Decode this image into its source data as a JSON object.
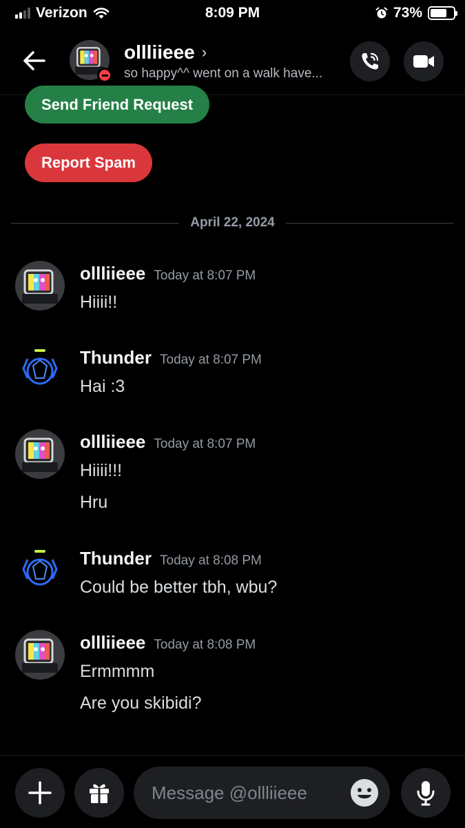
{
  "status_bar": {
    "carrier": "Verizon",
    "time": "8:09 PM",
    "battery_percent": "73%",
    "battery_level": 0.73
  },
  "header": {
    "username": "ollliieee",
    "chevron": "›",
    "custom_status": "so happy^^ went on a walk have...",
    "presence": "do-not-disturb"
  },
  "actions": {
    "send_friend_request": "Send Friend Request",
    "report_spam": "Report Spam"
  },
  "date_divider": "April 22, 2024",
  "messages": [
    {
      "author": "ollliieee",
      "timestamp": "Today at 8:07 PM",
      "lines": [
        "Hiiii!!"
      ]
    },
    {
      "author": "Thunder",
      "timestamp": "Today at 8:07 PM",
      "lines": [
        "Hai :3"
      ]
    },
    {
      "author": "ollliieee",
      "timestamp": "Today at 8:07 PM",
      "lines": [
        "Hiiii!!!",
        "Hru"
      ]
    },
    {
      "author": "Thunder",
      "timestamp": "Today at 8:08 PM",
      "lines": [
        "Could be better tbh, wbu?"
      ]
    },
    {
      "author": "ollliieee",
      "timestamp": "Today at 8:08 PM",
      "lines": [
        "Ermmmm",
        "Are you skibidi?"
      ]
    }
  ],
  "composer": {
    "placeholder": "Message @ollliieee"
  },
  "colors": {
    "background": "#000000",
    "green_button": "#248046",
    "red_button": "#da373c",
    "dnd_red": "#f23f43",
    "muted_text": "#949ba4"
  },
  "icons": [
    "signal-icon",
    "wifi-icon",
    "alarm-icon",
    "battery-icon",
    "back-arrow-icon",
    "voice-call-icon",
    "video-call-icon",
    "plus-icon",
    "gift-icon",
    "emoji-icon",
    "microphone-icon"
  ]
}
